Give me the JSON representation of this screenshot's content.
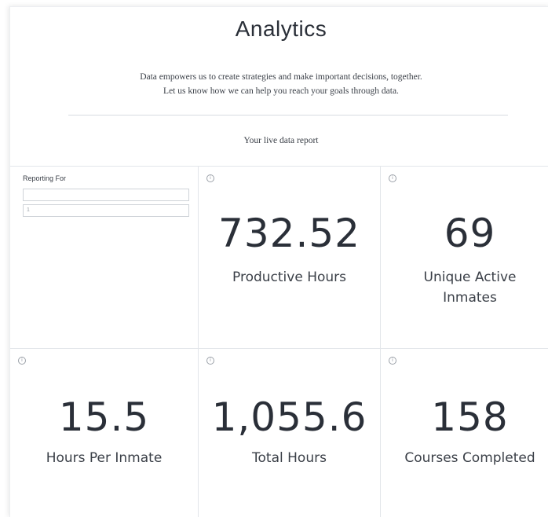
{
  "header": {
    "title": "Analytics",
    "intro_line1": "Data empowers us to create strategies and make important decisions, together.",
    "intro_line2": "Let us know how we can help you reach your goals through data.",
    "report_label": "Your live data report"
  },
  "filter": {
    "label": "Reporting For",
    "field1_value": "",
    "field2_value": "1"
  },
  "metrics": [
    {
      "value": "732.52",
      "label_line1": "Productive Hours",
      "label_line2": ""
    },
    {
      "value": "69",
      "label_line1": "Unique Active",
      "label_line2": "Inmates"
    },
    {
      "value": "15.5",
      "label_line1": "Hours Per Inmate",
      "label_line2": ""
    },
    {
      "value": "1,055.6",
      "label_line1": "Total Hours",
      "label_line2": ""
    },
    {
      "value": "158",
      "label_line1": "Courses Completed",
      "label_line2": ""
    }
  ],
  "icons": {
    "info": "info-icon"
  },
  "colors": {
    "text": "#2a2f38",
    "border": "#e3e6ea"
  }
}
